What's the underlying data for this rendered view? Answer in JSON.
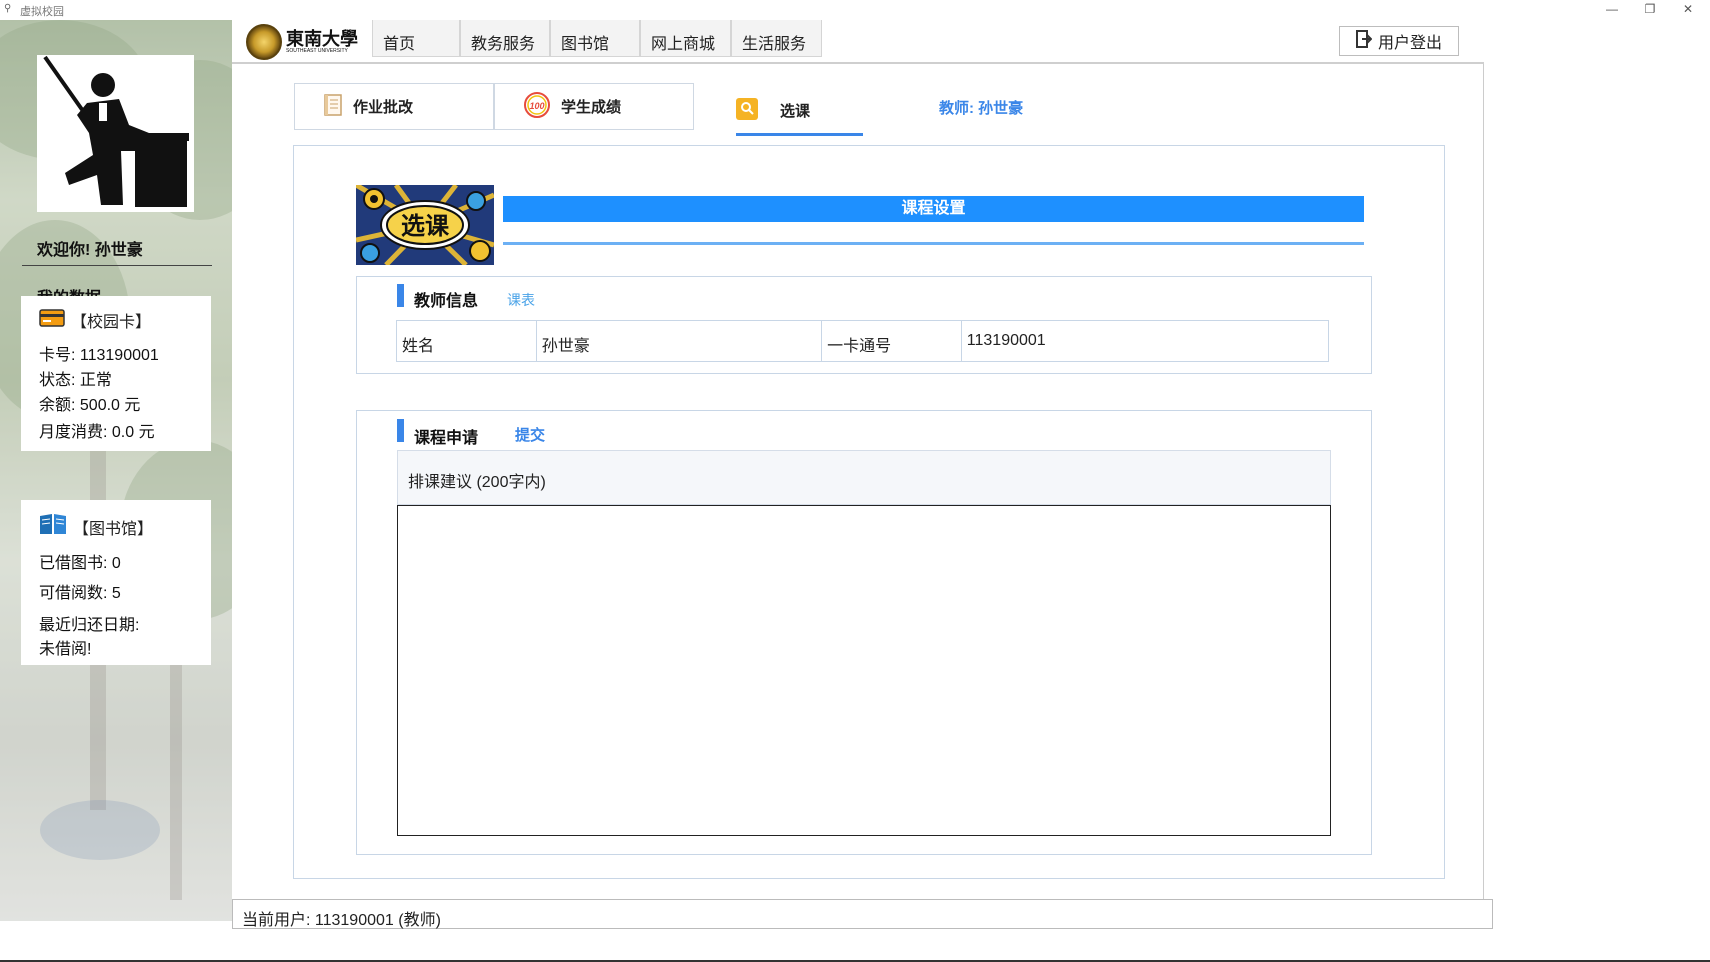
{
  "window": {
    "title": "虚拟校园",
    "controls": {
      "minimize": "—",
      "restore": "❐",
      "close": "✕"
    }
  },
  "sidebar": {
    "welcome": "欢迎你! 孙世豪",
    "my_data": "我的数据",
    "campus_card": {
      "title": "【校园卡】",
      "icon": "card-icon",
      "card_no": "卡号: 113190001",
      "status": "状态: 正常",
      "balance": "余额: 500.0 元",
      "monthly": "月度消费: 0.0 元"
    },
    "library": {
      "title": "【图书馆】",
      "icon": "book-icon",
      "borrowed": "已借图书: 0",
      "can_borrow": "可借阅数: 5",
      "recent_return_label": "最近归还日期:",
      "recent_return_value": "未借阅!"
    }
  },
  "header": {
    "logo_text": "東南大學",
    "logo_sub": "SOUTHEAST UNIVERSITY",
    "nav": [
      "首页",
      "教务服务",
      "图书馆",
      "网上商城",
      "生活服务"
    ],
    "logout": "用户登出"
  },
  "subtabs": {
    "grading": "作业批改",
    "scores": "学生成绩",
    "scores_badge": "100",
    "select": "选课",
    "teacher": "教师: 孙世豪"
  },
  "banner": {
    "image_text": "选课",
    "bar_title": "课程设置"
  },
  "teacher_info": {
    "title": "教师信息",
    "link": "课表",
    "name_label": "姓名",
    "name_value": "孙世豪",
    "card_label": "一卡通号",
    "card_value": "113190001"
  },
  "course_apply": {
    "title": "课程申请",
    "submit": "提交",
    "suggest_label": "排课建议 (200字内)",
    "suggest_value": ""
  },
  "status_bar": {
    "text": "当前用户: 113190001 (教师)"
  },
  "colors": {
    "accent": "#1e90ff",
    "link": "#4aa3e8",
    "section_mark": "#3a86e8"
  }
}
